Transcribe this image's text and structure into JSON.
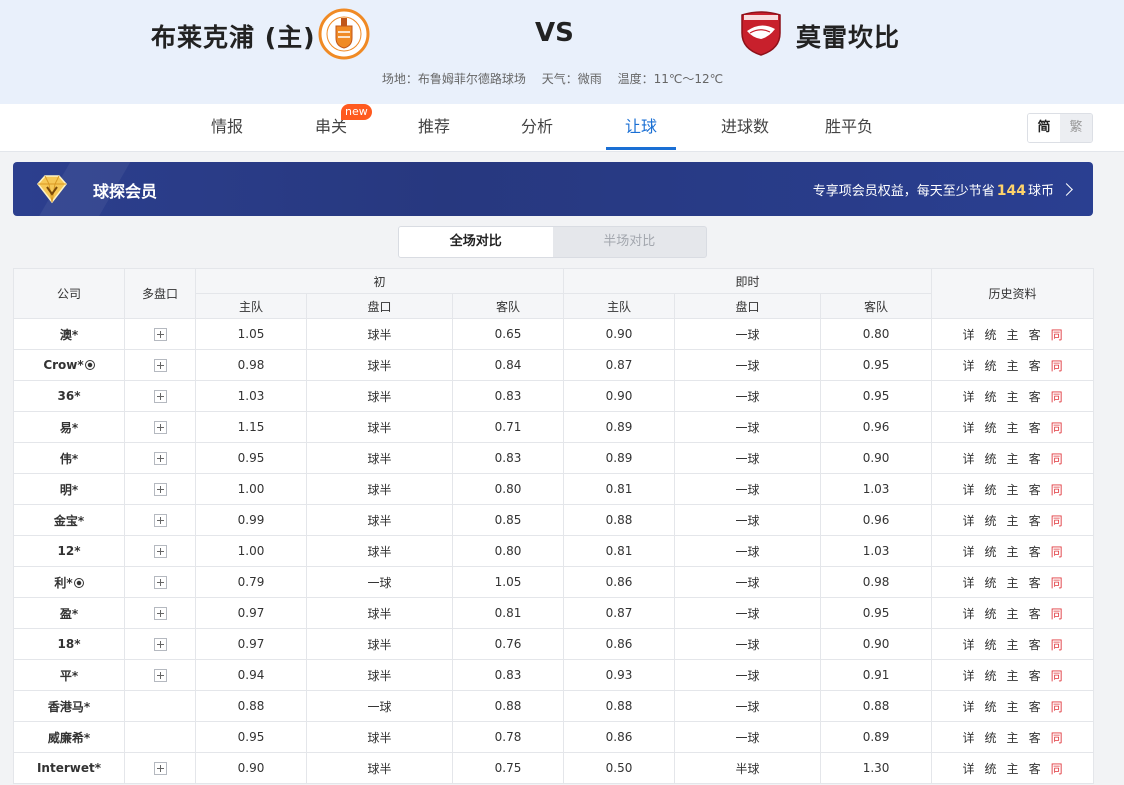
{
  "header": {
    "home_team": "布莱克浦 (主)",
    "vs": "VS",
    "away_team": "莫雷坎比",
    "venue": "场地：布鲁姆菲尔德路球场",
    "weather": "天气：微雨",
    "temperature": "温度：11℃～12℃",
    "home_logo_text": "BLACKPOOL FOOTBALL CLUB",
    "away_logo_text": "MORECAMBE FC"
  },
  "nav": {
    "items": [
      "情报",
      "串关",
      "推荐",
      "分析",
      "让球",
      "进球数",
      "胜平负"
    ],
    "active": "让球",
    "new_badge": "new",
    "lang_simplified": "简",
    "lang_traditional": "繁"
  },
  "member": {
    "title": "球探会员",
    "promo_prefix": "专享项会员权益，每天至少节省",
    "promo_amount": "144",
    "promo_suffix": "球币"
  },
  "toggle": {
    "full": "全场对比",
    "half": "半场对比"
  },
  "table": {
    "headers": {
      "company": "公司",
      "multi": "多盘口",
      "initial": "初",
      "live": "即时",
      "history": "历史资料",
      "home": "主队",
      "line": "盘口",
      "away": "客队"
    },
    "history_links": [
      "详",
      "统",
      "主",
      "客",
      "同"
    ],
    "rows": [
      {
        "company": "澳*",
        "ball": false,
        "multi": true,
        "i_home": "1.05",
        "i_line": "球半",
        "i_away": "0.65",
        "l_home": "0.90",
        "l_line": "一球",
        "l_away": "0.80"
      },
      {
        "company": "Crow*",
        "ball": true,
        "multi": true,
        "i_home": "0.98",
        "i_line": "球半",
        "i_away": "0.84",
        "l_home": "0.87",
        "l_line": "一球",
        "l_away": "0.95"
      },
      {
        "company": "36*",
        "ball": false,
        "multi": true,
        "i_home": "1.03",
        "i_line": "球半",
        "i_away": "0.83",
        "l_home": "0.90",
        "l_line": "一球",
        "l_away": "0.95"
      },
      {
        "company": "易*",
        "ball": false,
        "multi": true,
        "i_home": "1.15",
        "i_line": "球半",
        "i_away": "0.71",
        "l_home": "0.89",
        "l_line": "一球",
        "l_away": "0.96"
      },
      {
        "company": "伟*",
        "ball": false,
        "multi": true,
        "i_home": "0.95",
        "i_line": "球半",
        "i_away": "0.83",
        "l_home": "0.89",
        "l_line": "一球",
        "l_away": "0.90"
      },
      {
        "company": "明*",
        "ball": false,
        "multi": true,
        "i_home": "1.00",
        "i_line": "球半",
        "i_away": "0.80",
        "l_home": "0.81",
        "l_line": "一球",
        "l_away": "1.03"
      },
      {
        "company": "金宝*",
        "ball": false,
        "multi": true,
        "i_home": "0.99",
        "i_line": "球半",
        "i_away": "0.85",
        "l_home": "0.88",
        "l_line": "一球",
        "l_away": "0.96"
      },
      {
        "company": "12*",
        "ball": false,
        "multi": true,
        "i_home": "1.00",
        "i_line": "球半",
        "i_away": "0.80",
        "l_home": "0.81",
        "l_line": "一球",
        "l_away": "1.03"
      },
      {
        "company": "利*",
        "ball": true,
        "multi": true,
        "i_home": "0.79",
        "i_line": "一球",
        "i_away": "1.05",
        "l_home": "0.86",
        "l_line": "一球",
        "l_away": "0.98"
      },
      {
        "company": "盈*",
        "ball": false,
        "multi": true,
        "i_home": "0.97",
        "i_line": "球半",
        "i_away": "0.81",
        "l_home": "0.87",
        "l_line": "一球",
        "l_away": "0.95"
      },
      {
        "company": "18*",
        "ball": false,
        "multi": true,
        "i_home": "0.97",
        "i_line": "球半",
        "i_away": "0.76",
        "l_home": "0.86",
        "l_line": "一球",
        "l_away": "0.90"
      },
      {
        "company": "平*",
        "ball": false,
        "multi": true,
        "i_home": "0.94",
        "i_line": "球半",
        "i_away": "0.83",
        "l_home": "0.93",
        "l_line": "一球",
        "l_away": "0.91"
      },
      {
        "company": "香港马*",
        "ball": false,
        "multi": false,
        "i_home": "0.88",
        "i_line": "一球",
        "i_away": "0.88",
        "l_home": "0.88",
        "l_line": "一球",
        "l_away": "0.88"
      },
      {
        "company": "威廉希*",
        "ball": false,
        "multi": false,
        "i_home": "0.95",
        "i_line": "球半",
        "i_away": "0.78",
        "l_home": "0.86",
        "l_line": "一球",
        "l_away": "0.89"
      },
      {
        "company": "Interwet*",
        "ball": false,
        "multi": true,
        "i_home": "0.90",
        "i_line": "球半",
        "i_away": "0.75",
        "l_home": "0.50",
        "l_line": "半球",
        "l_away": "1.30"
      }
    ]
  },
  "colors": {
    "accent": "#1a6fd4",
    "member_bg": "#2c3f8e",
    "highlight": "#ffd36b",
    "history_red": "#e0393e"
  }
}
